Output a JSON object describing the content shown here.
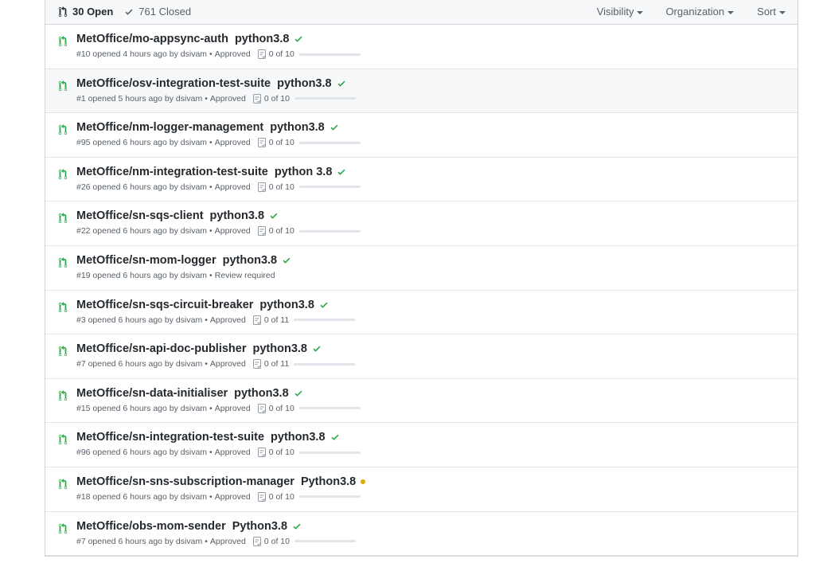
{
  "header": {
    "open_label": "30 Open",
    "closed_label": "761 Closed",
    "filters": {
      "visibility": "Visibility",
      "organization": "Organization",
      "sort": "Sort"
    }
  },
  "colors": {
    "success": "#28a745",
    "pending": "#dbab09",
    "pr_icon": "#28a745",
    "muted": "#586069"
  },
  "pull_requests": [
    {
      "title": "MetOffice/mo-appsync-auth",
      "tag": "python3.8",
      "status": "success",
      "meta": "#10 opened 4 hours ago by dsivam",
      "review": "Approved",
      "tasks": "0 of 10",
      "progress": 0
    },
    {
      "title": "MetOffice/osv-integration-test-suite",
      "tag": "python3.8",
      "status": "success",
      "meta": "#1 opened 5 hours ago by dsivam",
      "review": "Approved",
      "tasks": "0 of 10",
      "progress": 0
    },
    {
      "title": "MetOffice/nm-logger-management",
      "tag": "python3.8",
      "status": "success",
      "meta": "#95 opened 6 hours ago by dsivam",
      "review": "Approved",
      "tasks": "0 of 10",
      "progress": 0
    },
    {
      "title": "MetOffice/nm-integration-test-suite",
      "tag": "python 3.8",
      "status": "success",
      "meta": "#26 opened 6 hours ago by dsivam",
      "review": "Approved",
      "tasks": "0 of 10",
      "progress": 0
    },
    {
      "title": "MetOffice/sn-sqs-client",
      "tag": "python3.8",
      "status": "success",
      "meta": "#22 opened 6 hours ago by dsivam",
      "review": "Approved",
      "tasks": "0 of 10",
      "progress": 0
    },
    {
      "title": "MetOffice/sn-mom-logger",
      "tag": "python3.8",
      "status": "success",
      "meta": "#19 opened 6 hours ago by dsivam",
      "review": "Review required",
      "tasks": "",
      "progress": null
    },
    {
      "title": "MetOffice/sn-sqs-circuit-breaker",
      "tag": "python3.8",
      "status": "success",
      "meta": "#3 opened 6 hours ago by dsivam",
      "review": "Approved",
      "tasks": "0 of 11",
      "progress": 0
    },
    {
      "title": "MetOffice/sn-api-doc-publisher",
      "tag": "python3.8",
      "status": "success",
      "meta": "#7 opened 6 hours ago by dsivam",
      "review": "Approved",
      "tasks": "0 of 11",
      "progress": 0
    },
    {
      "title": "MetOffice/sn-data-initialiser",
      "tag": "python3.8",
      "status": "success",
      "meta": "#15 opened 6 hours ago by dsivam",
      "review": "Approved",
      "tasks": "0 of 10",
      "progress": 0
    },
    {
      "title": "MetOffice/sn-integration-test-suite",
      "tag": "python3.8",
      "status": "success",
      "meta": "#96 opened 6 hours ago by dsivam",
      "review": "Approved",
      "tasks": "0 of 10",
      "progress": 0
    },
    {
      "title": "MetOffice/sn-sns-subscription-manager",
      "tag": "Python3.8",
      "status": "pending",
      "meta": "#18 opened 6 hours ago by dsivam",
      "review": "Approved",
      "tasks": "0 of 10",
      "progress": 0
    },
    {
      "title": "MetOffice/obs-mom-sender",
      "tag": "Python3.8",
      "status": "success",
      "meta": "#7 opened 6 hours ago by dsivam",
      "review": "Approved",
      "tasks": "0 of 10",
      "progress": 0
    }
  ]
}
